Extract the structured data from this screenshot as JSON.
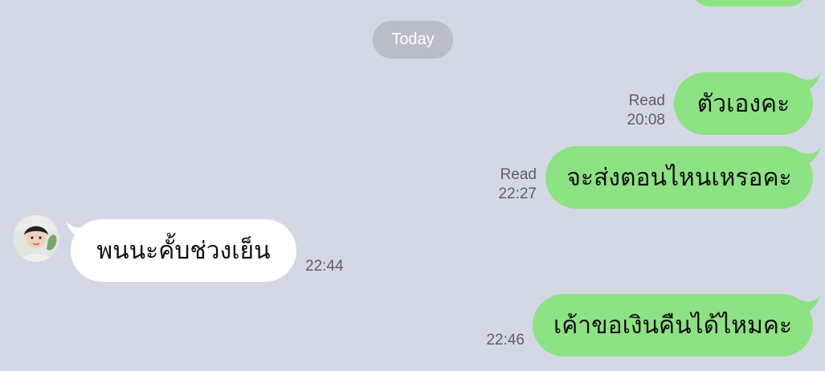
{
  "chat": {
    "date_label": "Today",
    "messages": [
      {
        "side": "out",
        "text": "ตัวเองคะ",
        "status": "Read",
        "time": "20:08"
      },
      {
        "side": "out",
        "text": "จะส่งตอนไหนเหรอคะ",
        "status": "Read",
        "time": "22:27"
      },
      {
        "side": "in",
        "text": "พนนะคั้บช่วงเย็น",
        "time": "22:44"
      },
      {
        "side": "out",
        "text": "เค้าขอเงินคืนได้ไหมคะ",
        "time": "22:46"
      }
    ]
  },
  "colors": {
    "background": "#d4d8e5",
    "outgoing_bubble": "#8de283",
    "incoming_bubble": "#ffffff",
    "date_pill": "#b9bdc7",
    "meta_text": "#5b5f68"
  },
  "icons": {
    "sender_avatar": "avatar-photo"
  }
}
